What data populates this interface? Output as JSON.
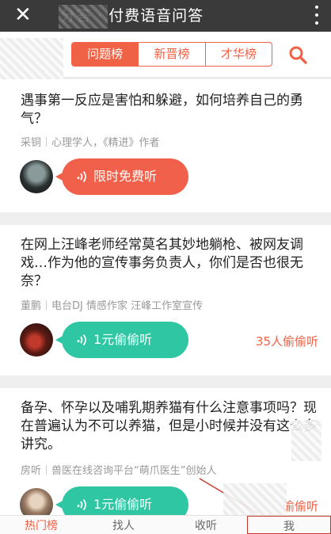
{
  "titlebar": {
    "close_glyph": "✕",
    "title": "分答 · 付费语音问答",
    "more_icon": "more-vertical-icon"
  },
  "tabs": [
    "问题榜",
    "新晋榜",
    "才华榜"
  ],
  "active_tab": 0,
  "cards": [
    {
      "question": "遇事第一反应是害怕和躲避，如何培养自己的勇气？",
      "author": "采铜",
      "title": "心理学人，《精进》作者",
      "button_label": "限时免费听",
      "button_color": "#f1604a",
      "listen_count": ""
    },
    {
      "question": "在网上汪峰老师经常莫名其妙地躺枪、被网友调戏…作为他的宣传事务负责人，你们是否也很无奈？",
      "author": "董鹏",
      "title": "电台DJ 情感作家 汪峰工作室宣传",
      "button_label": "1元偷偷听",
      "button_color": "#2fc7a3",
      "listen_count": "35人偷偷听"
    },
    {
      "question": "备孕、怀孕以及哺乳期养猫有什么注意事项吗？现在普遍认为不可以养猫，但是小时候并没有这么多讲究。",
      "author": "房听",
      "title": "兽医在线咨询平台“萌爪医生”创始人",
      "button_label": "1元偷偷听",
      "button_color": "#2fc7a3",
      "listen_count": "偷偷听"
    }
  ],
  "bottom_tabs": [
    "热门榜",
    "找人",
    "收听",
    "我"
  ],
  "colors": {
    "accent": "#f06245",
    "teal": "#2fc7a3",
    "titlebar": "#3a3a3a"
  }
}
